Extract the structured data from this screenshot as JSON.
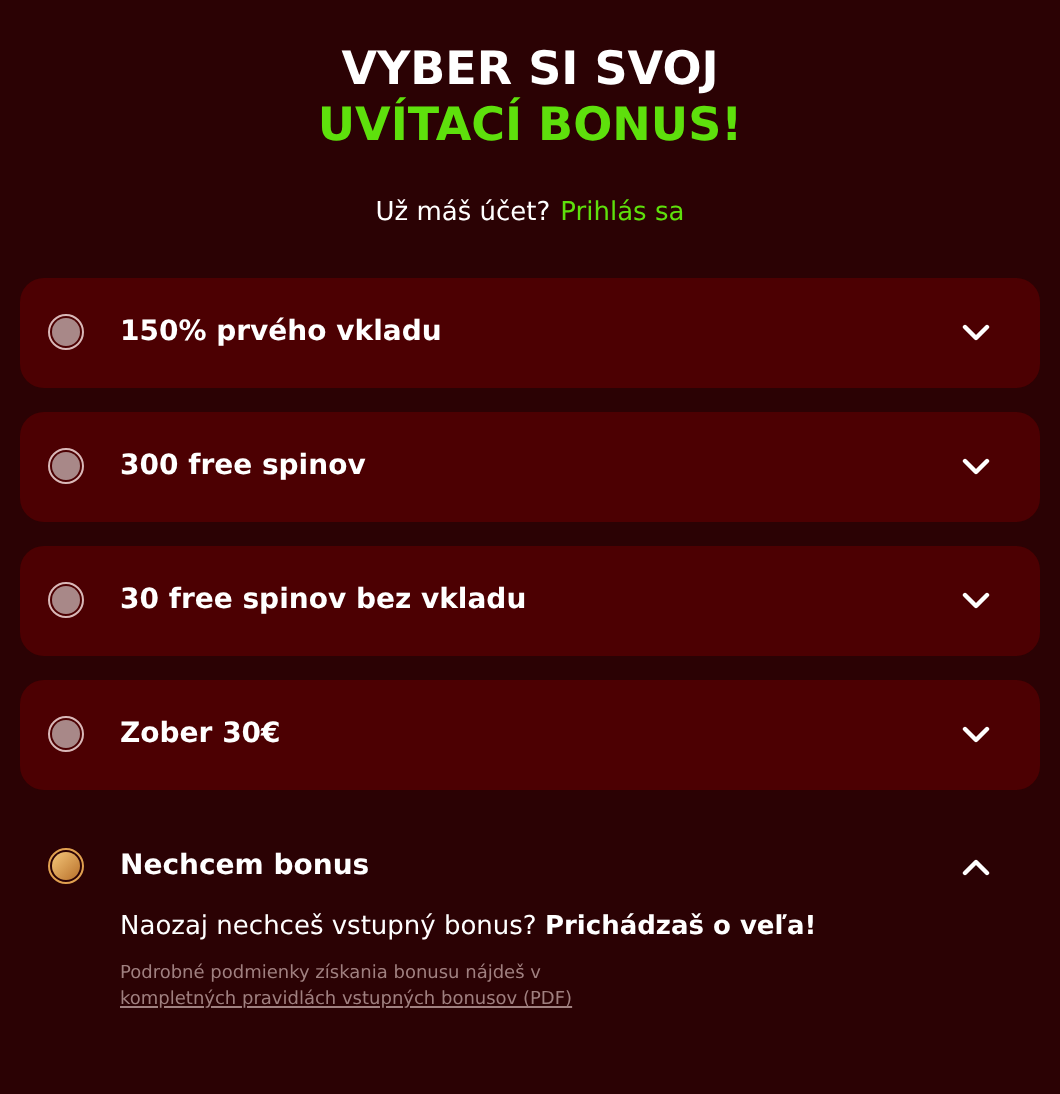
{
  "heading": {
    "line_1": "VYBER SI SVOJ",
    "line_2": "UVÍTACÍ BONUS!"
  },
  "login": {
    "prompt": "Už máš účet?",
    "link": "Prihlás sa"
  },
  "options": [
    {
      "label": "150% prvého vkladu",
      "selected": false,
      "expanded": false
    },
    {
      "label": "300 free spinov",
      "selected": false,
      "expanded": false
    },
    {
      "label": "30 free spinov bez vkladu",
      "selected": false,
      "expanded": false
    },
    {
      "label": "Zober 30€",
      "selected": false,
      "expanded": false
    },
    {
      "label": "Nechcem bonus",
      "selected": true,
      "expanded": true,
      "detail": "Naozaj nechceš vstupný bonus? **Prichádzaš o veľa!**",
      "fine_print": "Podrobné podmienky získania bonusu nájdeš v",
      "fine_print_link": "kompletných pravidlách vstupných bonusov (PDF)"
    }
  ]
}
